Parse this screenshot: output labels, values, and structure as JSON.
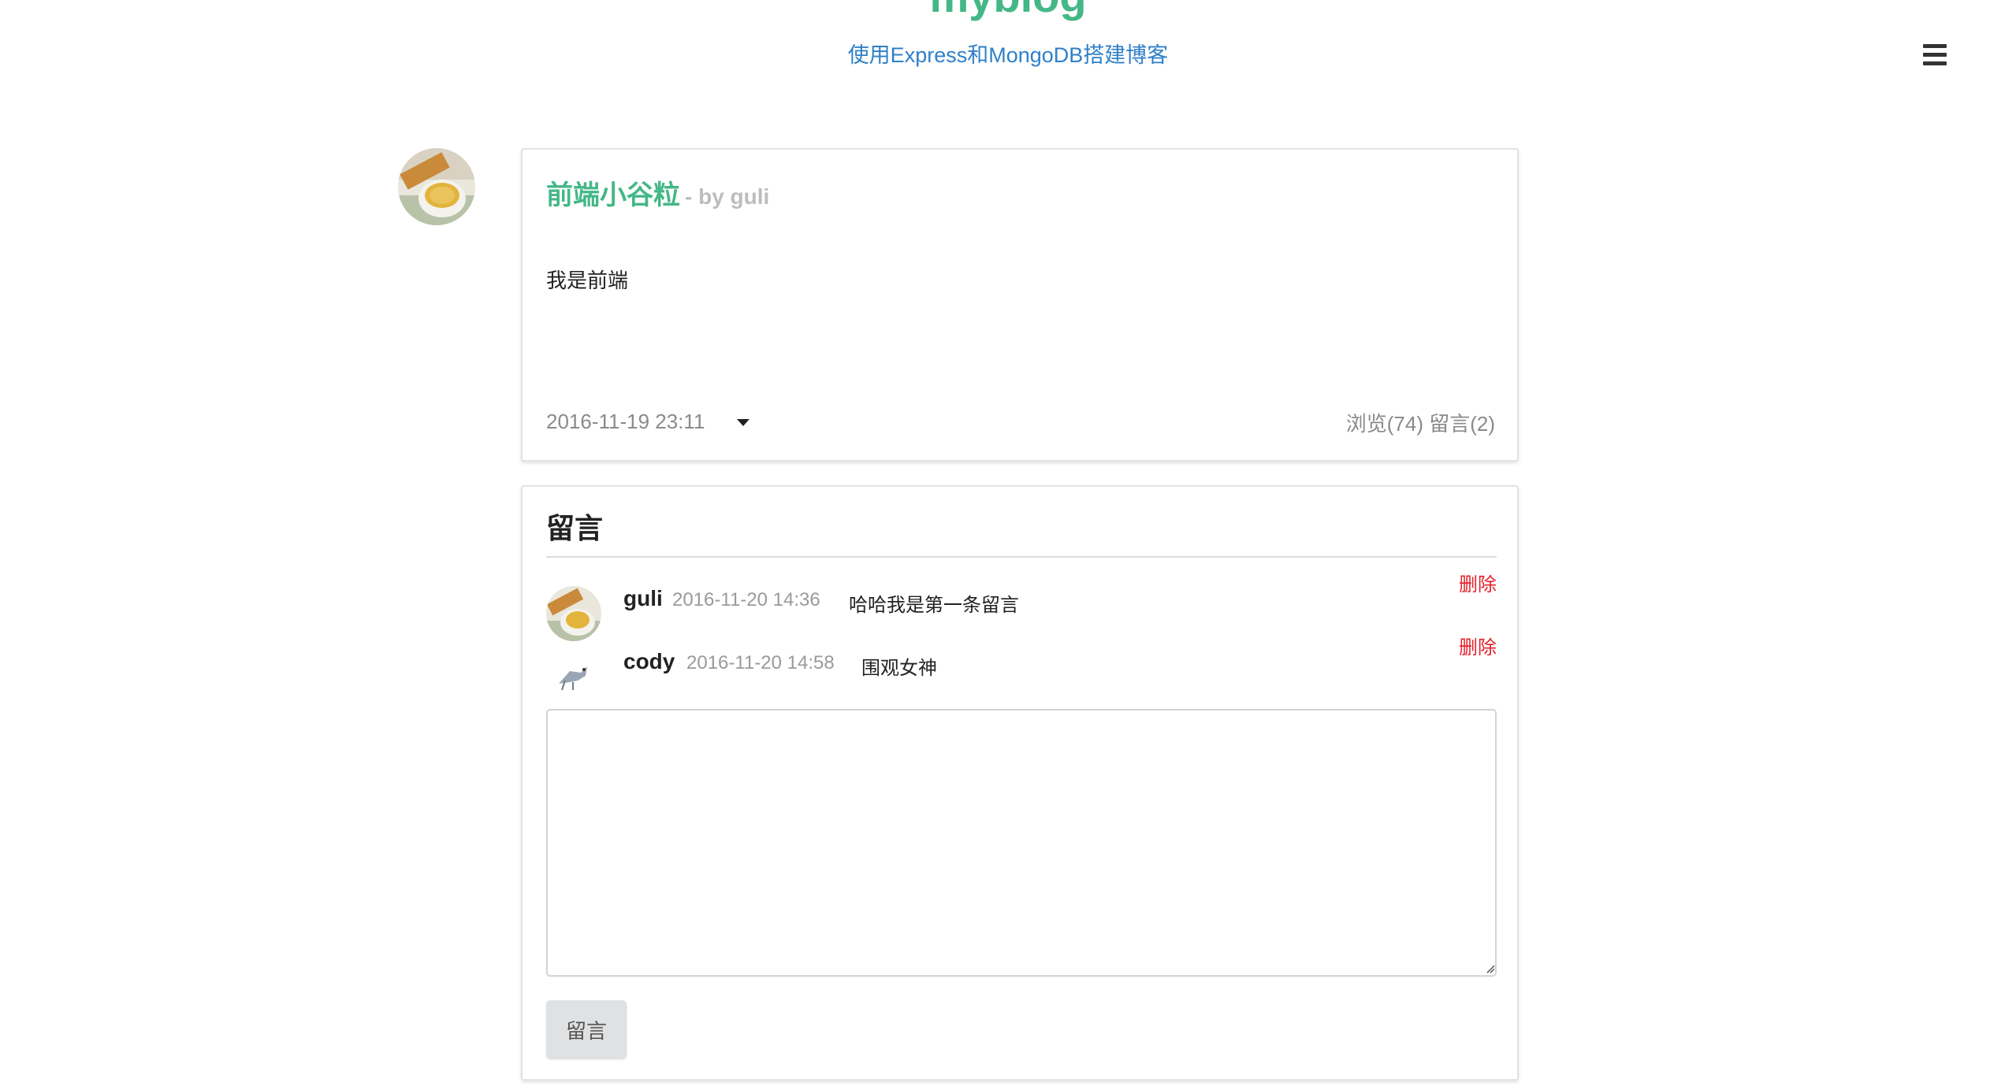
{
  "site": {
    "title": "myblog",
    "subtitle": "使用Express和MongoDB搭建博客"
  },
  "menu": {
    "icon": "hamburger-menu-icon"
  },
  "post": {
    "title": "前端小谷粒",
    "by": "- by guli",
    "content": "我是前端",
    "date": "2016-11-19 23:11",
    "stats": "浏览(74) 留言(2)",
    "author_avatar": "tea-cup-avatar"
  },
  "comments": {
    "header": "留言",
    "items": [
      {
        "user": "guli",
        "time": "2016-11-20 14:36",
        "text": "哈哈我是第一条留言",
        "delete_label": "删除",
        "avatar": "tea-cup-avatar"
      },
      {
        "user": "cody",
        "time": "2016-11-20 14:58",
        "text": "围观女神",
        "delete_label": "删除",
        "avatar": "bird-sketch-avatar"
      }
    ],
    "input_placeholder": "",
    "submit_label": "留言"
  },
  "colors": {
    "brand": "#44b787",
    "subtitle": "#2f80c9",
    "delete": "#e5202b",
    "muted": "#8a8a8a"
  }
}
